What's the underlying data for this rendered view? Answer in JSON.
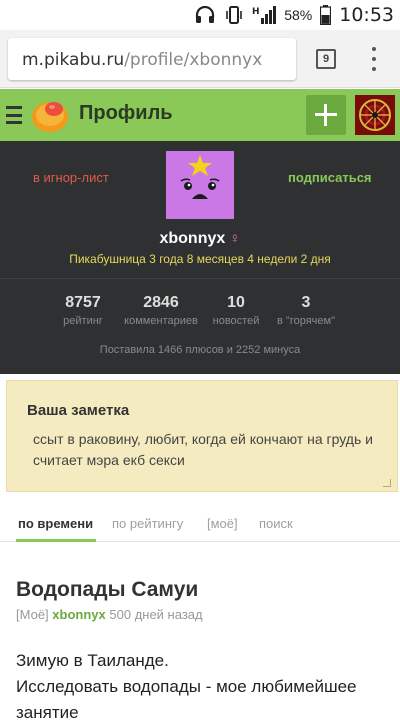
{
  "status_bar": {
    "icons": [
      "headphones-icon",
      "phone-vibrate-icon",
      "signal-h-icon",
      "battery-icon"
    ],
    "battery": "58%",
    "time": "10:53"
  },
  "browser": {
    "url_host": "m.pikabu.ru",
    "url_path": "/profile/xbonnyx",
    "tab_count": "9"
  },
  "app_bar": {
    "title": "Профиль",
    "accent": "#8ac858"
  },
  "profile": {
    "ignore_label": "в игнор-лист",
    "subscribe_label": "подписаться",
    "username": "xbonnyx",
    "gender_symbol": "♀",
    "since": "Пикабушница 3 года 8 месяцев 4 недели 2 дня",
    "stats": [
      {
        "value": "8757",
        "label": "рейтинг"
      },
      {
        "value": "2846",
        "label": "комментариев"
      },
      {
        "value": "10",
        "label": "новостей"
      },
      {
        "value": "3",
        "label": "в \"горячем\""
      }
    ],
    "votes": "Поставила 1466 плюсов и 2252 минуса"
  },
  "note": {
    "title": "Ваша заметка",
    "text": "ссыт в раковину, любит, когда ей кончают на грудь и считает мэра екб секси"
  },
  "sort_tabs": [
    {
      "label": "по времени",
      "active": true
    },
    {
      "label": "по рейтингу",
      "active": false
    },
    {
      "label": "[моё]",
      "active": false
    },
    {
      "label": "поиск",
      "active": false
    }
  ],
  "post": {
    "title": "Водопады Самуи",
    "tag": "[Моё]",
    "author": "xbonnyx",
    "age": "500 дней назад",
    "body_line1": "Зимую в Таиланде.",
    "body_line2": "Исследовать водопады - мое любимейшее занятие"
  }
}
